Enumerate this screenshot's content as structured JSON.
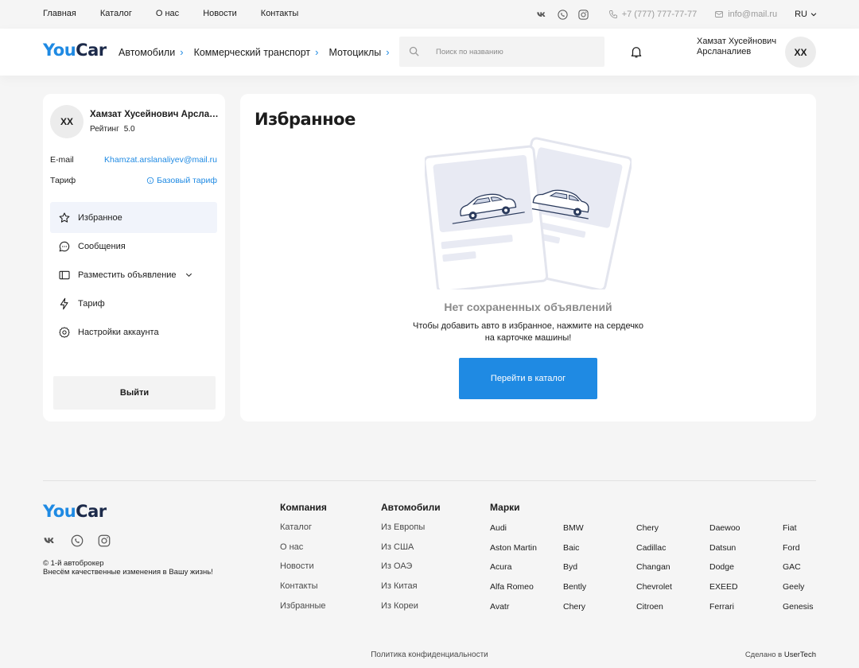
{
  "topbar": {
    "nav": [
      "Главная",
      "Каталог",
      "О нас",
      "Новости",
      "Контакты"
    ],
    "phone": "+7 (777) 777-77-77",
    "email": "info@mail.ru",
    "lang": "RU"
  },
  "header": {
    "logo_you": "You",
    "logo_car": "Car",
    "nav": [
      "Автомобили",
      "Коммерческий транспорт",
      "Мотоциклы"
    ],
    "search_placeholder": "Поиск по названию",
    "user_name_line1": "Хамзат Хусейнович",
    "user_name_line2": "Арсланалиев",
    "avatar": "ХХ"
  },
  "profile": {
    "avatar": "ХХ",
    "name": "Хамзат Хусейнович Арсланалиев",
    "rating_label": "Рейтинг",
    "rating_value": "5.0",
    "email_label": "E-mail",
    "email_value": "Khamzat.arslanaliyev@mail.ru",
    "tariff_label": "Тариф",
    "tariff_value": "Базовый тариф",
    "menu": [
      "Избранное",
      "Сообщения",
      "Разместить объявление",
      "Тариф",
      "Настройки аккаунта"
    ],
    "logout": "Выйти"
  },
  "main": {
    "title": "Избранное",
    "empty_title": "Нет сохраненных объявлений",
    "empty_text_1": "Чтобы добавить авто в избранное, нажмите на сердечко",
    "empty_text_2": "на карточке машины!",
    "cta": "Перейти в каталог"
  },
  "footer": {
    "logo_you": "You",
    "logo_car": "Car",
    "copy_1": "© 1-й автоброкер",
    "copy_2": "Внесём качественные изменения в Вашу жизнь!",
    "company_title": "Компания",
    "company": [
      "Каталог",
      "О нас",
      "Новости",
      "Контакты",
      "Избранные"
    ],
    "cars_title": "Автомобили",
    "cars": [
      "Из Европы",
      "Из США",
      "Из ОАЭ",
      "Из Китая",
      "Из Кореи"
    ],
    "brands_title": "Марки",
    "brands": [
      [
        "Audi",
        "Aston Martin",
        "Acura",
        "Alfa Romeo",
        "Avatr"
      ],
      [
        "BMW",
        "Baic",
        "Byd",
        "Bently",
        "Chery"
      ],
      [
        "Chery",
        "Cadillac",
        "Changan",
        "Chevrolet",
        "Citroen"
      ],
      [
        "Daewoo",
        "Datsun",
        "Dodge",
        "EXEED",
        "Ferrari"
      ],
      [
        "Fiat",
        "Ford",
        "GAC",
        "Geely",
        "Genesis"
      ]
    ],
    "policy": "Политика конфиденциальности",
    "made_prefix": "Сделано в",
    "made_by": "UserTech"
  },
  "colors": {
    "accent": "#1f8ae3",
    "logo_dark": "#1c2a4a",
    "bg": "#f5f5f5"
  }
}
